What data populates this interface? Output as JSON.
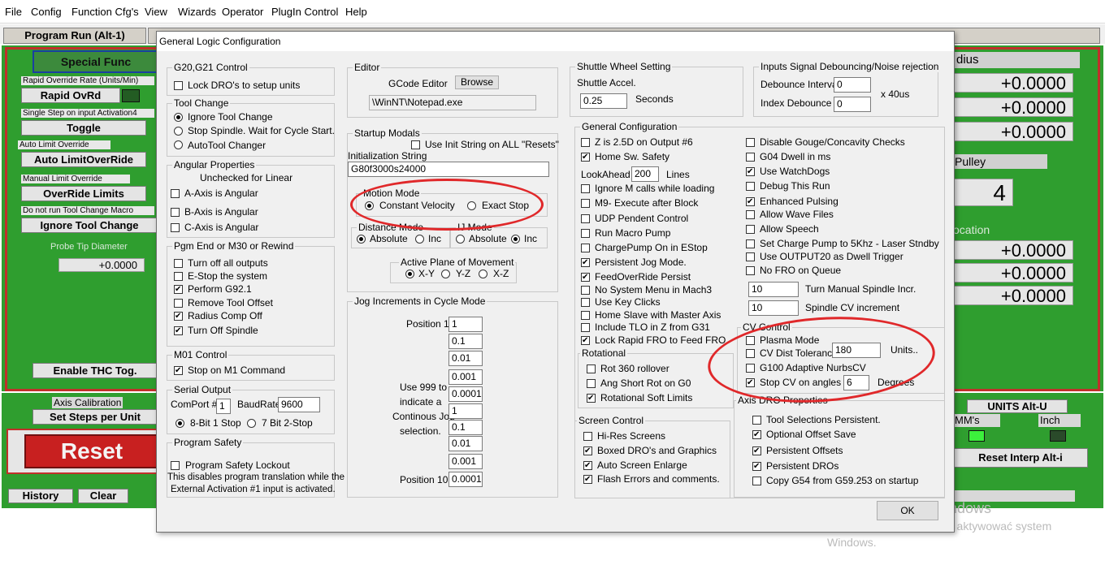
{
  "menu": [
    "File",
    "Config",
    "Function Cfg's",
    "View",
    "Wizards",
    "Operator",
    "PlugIn Control",
    "Help"
  ],
  "background": {
    "tab_program_run": "Program Run (Alt-1)",
    "special_func": "Special Func",
    "rapid_override_label": "Rapid Override Rate (Units/Min)",
    "rapid_ovrd": "Rapid OvRd",
    "single_step_label": "Single Step on input Activation4",
    "toggle": "Toggle",
    "auto_limit_label": "Auto Limit Override",
    "auto_limit_btn": "Auto LimitOverRide",
    "manual_limit_label": "Manual Limit Override",
    "override_limits": "OverRide Limits",
    "no_tool_change_label": "Do not run Tool Change Macro",
    "ignore_tool_change": "Ignore Tool Change",
    "probe_tip": "Probe Tip Diameter",
    "probe_value": "+0.0000",
    "enable_thc": "Enable THC Tog.",
    "axis_calibration": "Axis Calibration",
    "set_steps": "Set Steps per Unit",
    "reset": "Reset",
    "history": "History",
    "clear": "Clear",
    "radius": "dius",
    "dro1": "+0.0000",
    "dro2": "+0.0000",
    "dro3": "+0.0000",
    "pulley": "Pulley",
    "pulley_value": "4",
    "location": "ocation",
    "dro4": "+0.0000",
    "dro5": "+0.0000",
    "dro6": "+0.0000",
    "units": "UNITS Alt-U",
    "mms": "MM's",
    "inch": "Inch",
    "reset_interp": "Reset Interp Alt-i",
    "watermark_title": "Aktywuj system Windows",
    "watermark_sub1": "Przejdź do ustawień, aby aktywować system",
    "watermark_sub2": "Windows."
  },
  "dialog": {
    "title": "General Logic Configuration",
    "g20": {
      "title": "G20,G21 Control",
      "lock_dro": "Lock DRO's to setup units"
    },
    "tool_change": {
      "title": "Tool Change",
      "opt1": "Ignore Tool Change",
      "opt2": "Stop Spindle. Wait for Cycle Start.",
      "opt3": "AutoTool Changer"
    },
    "angular": {
      "title": "Angular Properties",
      "note": "Unchecked for Linear",
      "a": "A-Axis is Angular",
      "b": "B-Axis is Angular",
      "c": "C-Axis is Angular"
    },
    "pgm_end": {
      "title": "Pgm End or M30 or Rewind",
      "o1": "Turn off all outputs",
      "o2": "E-Stop the system",
      "o3": "Perform G92.1",
      "o4": "Remove Tool Offset",
      "o5": "Radius Comp Off",
      "o6": "Turn Off Spindle"
    },
    "m01": {
      "title": "M01 Control",
      "stop": "Stop on M1 Command"
    },
    "serial": {
      "title": "Serial Output",
      "comport_label": "ComPort #",
      "comport": "1",
      "baud_label": "BaudRate",
      "baud": "9600",
      "opt1": "8-Bit 1 Stop",
      "opt2": "7 Bit 2-Stop"
    },
    "safety": {
      "title": "Program Safety",
      "lockout": "Program Safety Lockout",
      "desc1": "This disables program translation while the",
      "desc2": "External Activation #1 input is activated."
    },
    "editor": {
      "title": "Editor",
      "gcode_editor": "GCode Editor",
      "browse": "Browse",
      "path": "\\WinNT\\Notepad.exe"
    },
    "startup": {
      "title": "Startup Modals",
      "use_init": "Use Init String on ALL  \"Resets\"",
      "init_label": "Initialization String",
      "init_value": "G80f3000s24000",
      "motion_title": "Motion Mode",
      "cv": "Constant Velocity",
      "exact": "Exact Stop",
      "dist_title": "Distance Mode",
      "abs": "Absolute",
      "inc": "Inc",
      "ij_title": "IJ Mode",
      "ij_abs": "Absolute",
      "ij_inc": "Inc",
      "plane_title": "Active Plane of Movement",
      "xy": "X-Y",
      "yz": "Y-Z",
      "xz": "X-Z"
    },
    "jog": {
      "title": "Jog Increments in Cycle Mode",
      "pos1": "Position 1",
      "pos10": "Position 10",
      "note1": "Use 999 to",
      "note2": "indicate a",
      "note3": "Continous Jog",
      "note4": "selection.",
      "values": [
        "1",
        "0.1",
        "0.01",
        "0.001",
        "0.0001",
        "1",
        "0.1",
        "0.01",
        "0.001",
        "0.0001"
      ]
    },
    "shuttle": {
      "title": "Shuttle Wheel Setting",
      "accel": "Shuttle Accel.",
      "value": "0.25",
      "seconds": "Seconds"
    },
    "debounce": {
      "title": "Inputs Signal Debouncing/Noise rejection",
      "interval": "Debounce Interval",
      "interval_value": "0",
      "index": "Index Debounce",
      "index_value": "0",
      "unit": "x 40us"
    },
    "general": {
      "title": "General Configuration",
      "left": [
        "Z is 2.5D on Output #6",
        "Home Sw. Safety",
        "Ignore M calls while loading",
        "M9- Execute after Block",
        "UDP Pendent Control",
        "Run Macro Pump",
        "ChargePump On in EStop",
        "Persistent Jog Mode.",
        "FeedOverRide Persist",
        "No System Menu in Mach3",
        "Use Key Clicks",
        "Home Slave with Master Axis",
        "Include TLO in Z from G31",
        "Lock Rapid FRO to Feed FRO"
      ],
      "lookahead_label": "LookAhead",
      "lookahead_value": "200",
      "lines": "Lines",
      "right": [
        "Disable Gouge/Concavity Checks",
        "G04 Dwell in ms",
        "Use WatchDogs",
        "Debug This Run",
        "Enhanced Pulsing",
        "Allow Wave Files",
        "Allow Speech",
        "Set Charge Pump to 5Khz  - Laser Stndby",
        "Use OUTPUT20 as Dwell Trigger",
        "No FRO on Queue"
      ],
      "turn_manual_value": "10",
      "turn_manual": "Turn Manual Spindle Incr.",
      "spindle_cv_value": "10",
      "spindle_cv": "Spindle CV increment"
    },
    "rotational": {
      "title": "Rotational",
      "r1": "Rot 360 rollover",
      "r2": "Ang Short Rot on G0",
      "r3": "Rotational Soft Limits"
    },
    "cv": {
      "title": "CV Control",
      "plasma": "Plasma Mode",
      "dist_tol": "CV Dist Tolerance",
      "dist_value": "180",
      "units": "Units..",
      "g100": "G100 Adaptive NurbsCV",
      "stop_cv": "Stop CV on angles >",
      "stop_value": "6",
      "degrees": "Degrees"
    },
    "screen": {
      "title": "Screen Control",
      "s1": "Hi-Res Screens",
      "s2": "Boxed DRO's and Graphics",
      "s3": "Auto Screen Enlarge",
      "s4": "Flash Errors and comments."
    },
    "axis_dro": {
      "title": "Axis DRO Properties",
      "a1": "Tool Selections Persistent.",
      "a2": "Optional Offset Save",
      "a3": "Persistent Offsets",
      "a4": "Persistent DROs",
      "a5": "Copy G54 from G59.253 on startup"
    },
    "ok": "OK"
  },
  "colors": {
    "green": "#2f9e2f",
    "red_frame": "#c0302a",
    "annotation": "#e0282a",
    "dialog_bg": "#f0f0f0"
  }
}
